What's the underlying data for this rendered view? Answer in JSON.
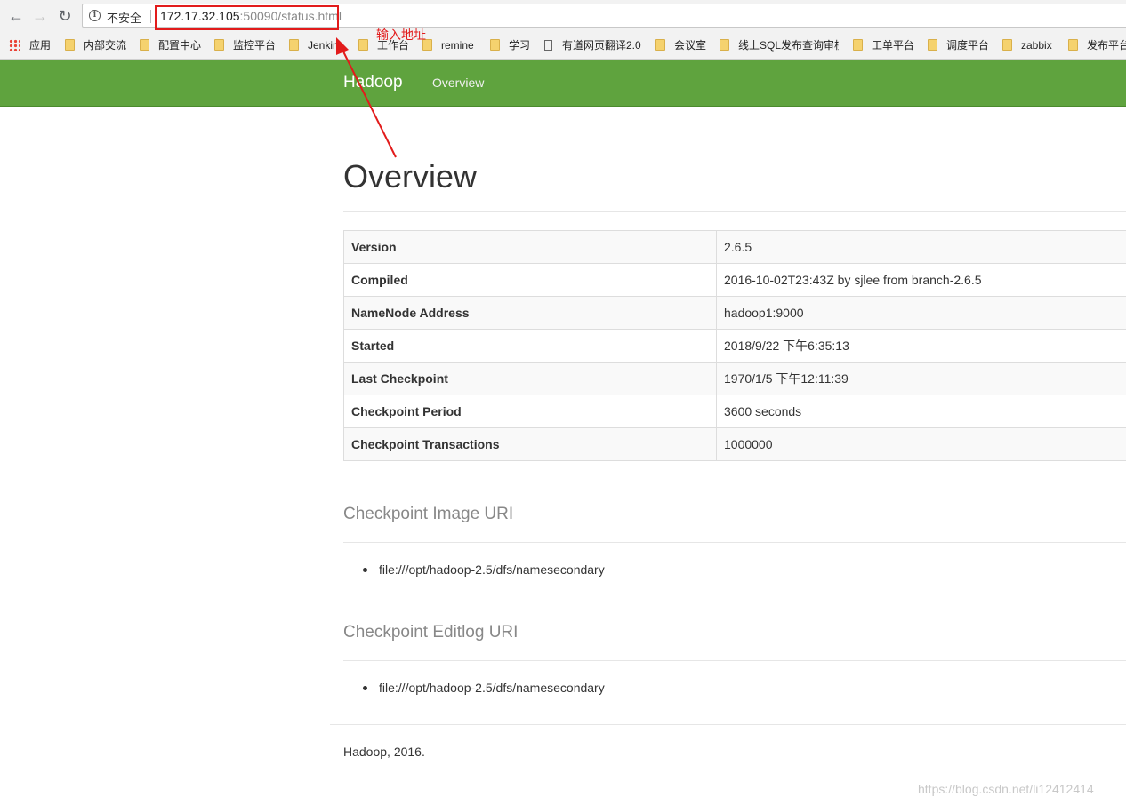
{
  "browser": {
    "back_icon": "arrow-left-icon",
    "forward_icon": "arrow-right-icon",
    "reload_icon": "reload-icon",
    "security_label": "不安全",
    "url_host": "172.17.32.105",
    "url_rest": ":50090/status.html"
  },
  "bookmarks": [
    {
      "label": "应用",
      "icon": "apps-icon"
    },
    {
      "label": "内部交流",
      "icon": "folder-icon"
    },
    {
      "label": "配置中心",
      "icon": "folder-icon"
    },
    {
      "label": "监控平台",
      "icon": "folder-icon"
    },
    {
      "label": "Jenkins",
      "icon": "folder-icon"
    },
    {
      "label": "工作台",
      "icon": "folder-icon"
    },
    {
      "label": "remine",
      "icon": "folder-icon"
    },
    {
      "label": "学习",
      "icon": "folder-icon"
    },
    {
      "label": "有道网页翻译2.0",
      "icon": "document-icon"
    },
    {
      "label": "会议室",
      "icon": "folder-icon"
    },
    {
      "label": "线上SQL发布查询审核",
      "icon": "folder-icon"
    },
    {
      "label": "工单平台",
      "icon": "folder-icon"
    },
    {
      "label": "调度平台",
      "icon": "folder-icon"
    },
    {
      "label": "zabbix",
      "icon": "folder-icon"
    },
    {
      "label": "发布平台",
      "icon": "folder-icon"
    }
  ],
  "navbar": {
    "brand": "Hadoop",
    "overview_link": "Overview",
    "background_color": "#5fa33e"
  },
  "main": {
    "title": "Overview",
    "info_rows": [
      {
        "key": "Version",
        "value": "2.6.5"
      },
      {
        "key": "Compiled",
        "value": "2016-10-02T23:43Z by sjlee from branch-2.6.5"
      },
      {
        "key": "NameNode Address",
        "value": "hadoop1:9000"
      },
      {
        "key": "Started",
        "value": "2018/9/22 下午6:35:13"
      },
      {
        "key": "Last Checkpoint",
        "value": "1970/1/5 下午12:11:39"
      },
      {
        "key": "Checkpoint Period",
        "value": "3600 seconds"
      },
      {
        "key": "Checkpoint Transactions",
        "value": "1000000"
      }
    ],
    "image_uri_title": "Checkpoint Image URI",
    "image_uris": [
      "file:///opt/hadoop-2.5/dfs/namesecondary"
    ],
    "editlog_uri_title": "Checkpoint Editlog URI",
    "editlog_uris": [
      "file:///opt/hadoop-2.5/dfs/namesecondary"
    ]
  },
  "footer": {
    "text": "Hadoop, 2016."
  },
  "annotation": {
    "text": "输入地址",
    "color": "#e21b1b"
  },
  "watermark": "https://blog.csdn.net/li12412414"
}
